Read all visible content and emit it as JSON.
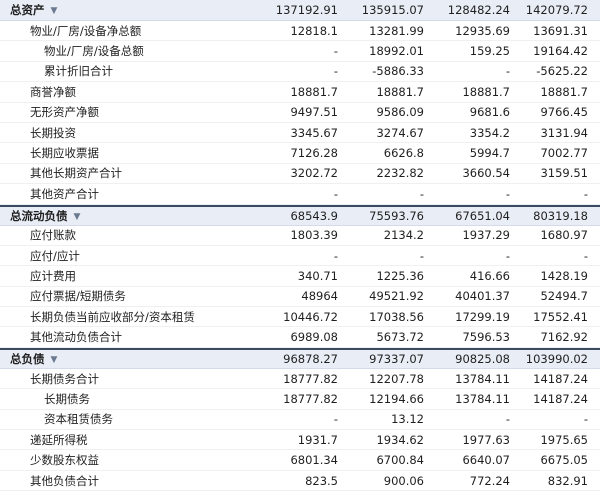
{
  "rows": [
    {
      "label": "总资产",
      "level": 0,
      "section": true,
      "values": [
        "137192.91",
        "135915.07",
        "128482.24",
        "142079.72"
      ]
    },
    {
      "label": "物业/厂房/设备净总额",
      "level": 1,
      "values": [
        "12818.1",
        "13281.99",
        "12935.69",
        "13691.31"
      ]
    },
    {
      "label": "物业/厂房/设备总额",
      "level": 2,
      "values": [
        "-",
        "18992.01",
        "159.25",
        "19164.42"
      ]
    },
    {
      "label": "累计折旧合计",
      "level": 2,
      "values": [
        "-",
        "-5886.33",
        "-",
        "-5625.22"
      ]
    },
    {
      "label": "商誉净额",
      "level": 1,
      "values": [
        "18881.7",
        "18881.7",
        "18881.7",
        "18881.7"
      ]
    },
    {
      "label": "无形资产净额",
      "level": 1,
      "values": [
        "9497.51",
        "9586.09",
        "9681.6",
        "9766.45"
      ]
    },
    {
      "label": "长期投资",
      "level": 1,
      "values": [
        "3345.67",
        "3274.67",
        "3354.2",
        "3131.94"
      ]
    },
    {
      "label": "长期应收票据",
      "level": 1,
      "values": [
        "7126.28",
        "6626.8",
        "5994.7",
        "7002.77"
      ]
    },
    {
      "label": "其他长期资产合计",
      "level": 1,
      "values": [
        "3202.72",
        "2232.82",
        "3660.54",
        "3159.51"
      ]
    },
    {
      "label": "其他资产合计",
      "level": 1,
      "values": [
        "-",
        "-",
        "-",
        "-"
      ]
    },
    {
      "label": "总流动负债",
      "level": 0,
      "section": true,
      "values": [
        "68543.9",
        "75593.76",
        "67651.04",
        "80319.18"
      ]
    },
    {
      "label": "应付账款",
      "level": 1,
      "values": [
        "1803.39",
        "2134.2",
        "1937.29",
        "1680.97"
      ]
    },
    {
      "label": "应付/应计",
      "level": 1,
      "values": [
        "-",
        "-",
        "-",
        "-"
      ]
    },
    {
      "label": "应计费用",
      "level": 1,
      "values": [
        "340.71",
        "1225.36",
        "416.66",
        "1428.19"
      ]
    },
    {
      "label": "应付票据/短期债务",
      "level": 1,
      "values": [
        "48964",
        "49521.92",
        "40401.37",
        "52494.7"
      ]
    },
    {
      "label": "长期负债当前应收部分/资本租赁",
      "level": 1,
      "values": [
        "10446.72",
        "17038.56",
        "17299.19",
        "17552.41"
      ]
    },
    {
      "label": "其他流动负债合计",
      "level": 1,
      "values": [
        "6989.08",
        "5673.72",
        "7596.53",
        "7162.92"
      ]
    },
    {
      "label": "总负债",
      "level": 0,
      "section": true,
      "values": [
        "96878.27",
        "97337.07",
        "90825.08",
        "103990.02"
      ]
    },
    {
      "label": "长期债务合计",
      "level": 1,
      "values": [
        "18777.82",
        "12207.78",
        "13784.11",
        "14187.24"
      ]
    },
    {
      "label": "长期债务",
      "level": 2,
      "values": [
        "18777.82",
        "12194.66",
        "13784.11",
        "14187.24"
      ]
    },
    {
      "label": "资本租赁债务",
      "level": 2,
      "values": [
        "-",
        "13.12",
        "-",
        "-"
      ]
    },
    {
      "label": "递延所得税",
      "level": 1,
      "values": [
        "1931.7",
        "1934.62",
        "1977.63",
        "1975.65"
      ]
    },
    {
      "label": "少数股东权益",
      "level": 1,
      "values": [
        "6801.34",
        "6700.84",
        "6640.07",
        "6675.05"
      ]
    },
    {
      "label": "其他负债合计",
      "level": 1,
      "values": [
        "823.5",
        "900.06",
        "772.24",
        "832.91"
      ]
    }
  ],
  "icons": {
    "expand": "chevron-down-icon"
  }
}
